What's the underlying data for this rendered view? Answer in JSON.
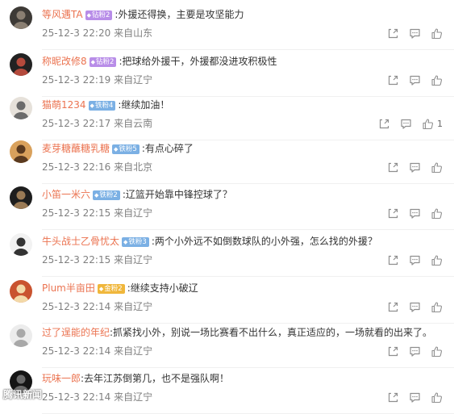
{
  "watermark": "腾讯新闻",
  "comments": [
    {
      "username": "等风遇TA",
      "badge": "钻粉2",
      "badge_color": "#b88de8",
      "text": ":外援还得换，主要是攻坚能力",
      "time": "25-12-3 22:20",
      "location": "来自山东",
      "likes": ""
    },
    {
      "username": "称昵改修8",
      "badge": "钻粉2",
      "badge_color": "#b88de8",
      "text": ":把球给外援干，外援都没进攻积极性",
      "time": "25-12-3 22:19",
      "location": "来自辽宁",
      "likes": ""
    },
    {
      "username": "猫萌1234",
      "badge": "铁粉4",
      "badge_color": "#7bb0e4",
      "text": ":继续加油！",
      "time": "25-12-3 22:17",
      "location": "来自云南",
      "likes": "1"
    },
    {
      "username": "麦芽糖蘸糖乳糖",
      "badge": "铁粉5",
      "badge_color": "#7bb0e4",
      "text": ":有点心碎了",
      "time": "25-12-3 22:16",
      "location": "来自北京",
      "likes": ""
    },
    {
      "username": "小笛一米六",
      "badge": "铁粉2",
      "badge_color": "#7bb0e4",
      "text": ":辽篮开始靠中锋控球了？",
      "time": "25-12-3 22:15",
      "location": "来自辽宁",
      "likes": ""
    },
    {
      "username": "牛头战士乙骨忧太",
      "badge": "铁粉3",
      "badge_color": "#7bb0e4",
      "text": ":两个小外远不如倒数球队的小外强，怎么找的外援？",
      "time": "25-12-3 22:15",
      "location": "来自辽宁",
      "likes": ""
    },
    {
      "username": "Plum半亩田",
      "badge": "金粉2",
      "badge_color": "#f0b73c",
      "text": ":继续支持小破辽",
      "time": "25-12-3 22:14",
      "location": "来自辽宁",
      "likes": ""
    },
    {
      "username": "过了逞能的年纪",
      "badge": "",
      "badge_color": "",
      "text": ":抓紧找小外，别说一场比赛看不出什么，真正适应的，一场就看的出来了。",
      "time": "25-12-3 22:14",
      "location": "来自辽宁",
      "likes": ""
    },
    {
      "username": "玩味一郎",
      "badge": "",
      "badge_color": "",
      "text": ":去年江苏倒第几，也不是强队啊！",
      "time": "25-12-3 22:14",
      "location": "来自辽宁",
      "likes": ""
    }
  ]
}
